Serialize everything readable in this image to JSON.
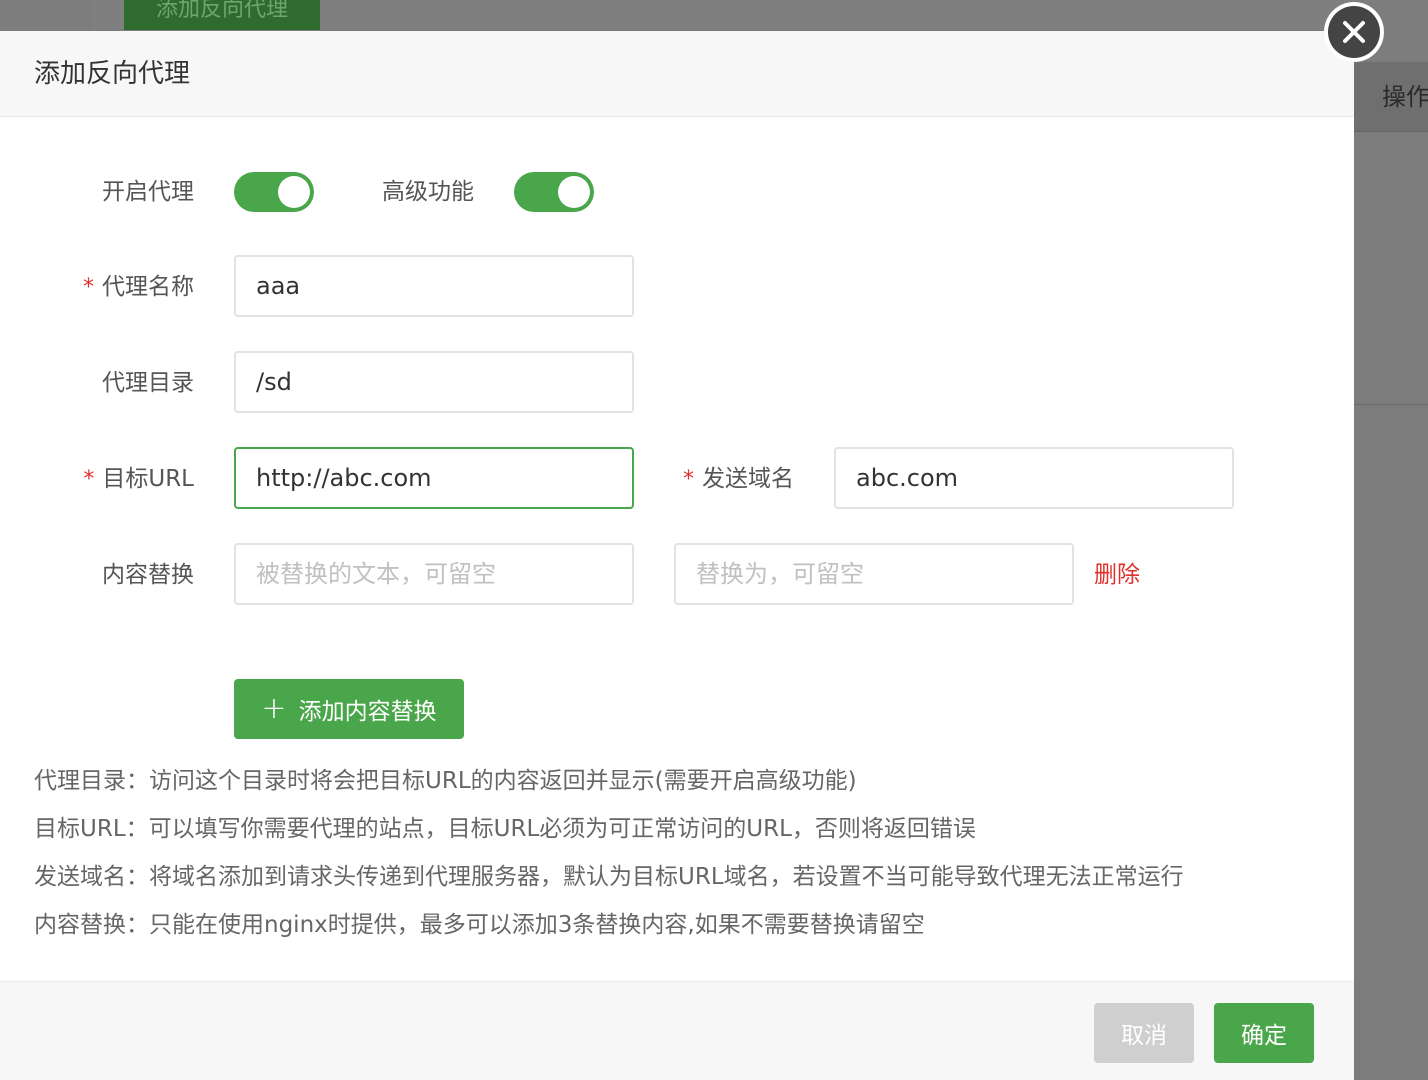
{
  "background": {
    "button_label": "添加反向代理",
    "right_header": "操作"
  },
  "modal": {
    "title": "添加反向代理",
    "fields": {
      "enable_proxy_label": "开启代理",
      "advanced_label": "高级功能",
      "proxy_name_label": "代理名称",
      "proxy_name_value": "aaa",
      "proxy_dir_label": "代理目录",
      "proxy_dir_value": "/sd",
      "target_url_label": "目标URL",
      "target_url_value": "http://abc.com",
      "send_domain_label": "发送域名",
      "send_domain_value": "abc.com",
      "content_replace_label": "内容替换",
      "replace_from_placeholder": "被替换的文本，可留空",
      "replace_to_placeholder": "替换为，可留空",
      "delete_label": "删除",
      "required_mark": "*"
    },
    "toggles": {
      "enable_proxy_on": true,
      "advanced_on": true
    },
    "add_replace_button": {
      "icon": "+",
      "label": "添加内容替换"
    },
    "help_lines": [
      "代理目录：访问这个目录时将会把目标URL的内容返回并显示(需要开启高级功能)",
      "目标URL：可以填写你需要代理的站点，目标URL必须为可正常访问的URL，否则将返回错误",
      "发送域名：将域名添加到请求头传递到代理服务器，默认为目标URL域名，若设置不当可能导致代理无法正常运行",
      "内容替换：只能在使用nginx时提供，最多可以添加3条替换内容,如果不需要替换请留空"
    ],
    "footer": {
      "cancel_label": "取消",
      "ok_label": "确定"
    }
  },
  "colors": {
    "primary_green": "#4aa64a",
    "danger_red": "#e0302b"
  }
}
